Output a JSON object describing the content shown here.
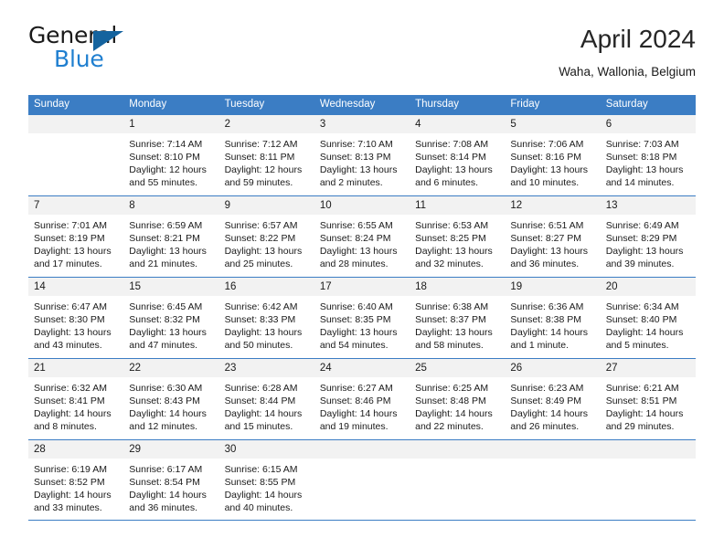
{
  "logo": {
    "word_one": "General",
    "word_two": "Blue",
    "triangle_color": "#14639e",
    "blue_color": "#1f7fd0"
  },
  "header": {
    "title": "April 2024",
    "location": "Waha, Wallonia, Belgium"
  },
  "theme": {
    "header_blue": "#3b7dc4",
    "daynum_bg": "#f2f2f2",
    "text": "#1a1a1a"
  },
  "calendar": {
    "weekdays": [
      "Sunday",
      "Monday",
      "Tuesday",
      "Wednesday",
      "Thursday",
      "Friday",
      "Saturday"
    ],
    "weeks": [
      [
        {
          "day": "",
          "sunrise": "",
          "sunset": "",
          "daylight": ""
        },
        {
          "day": "1",
          "sunrise": "Sunrise: 7:14 AM",
          "sunset": "Sunset: 8:10 PM",
          "daylight": "Daylight: 12 hours and 55 minutes."
        },
        {
          "day": "2",
          "sunrise": "Sunrise: 7:12 AM",
          "sunset": "Sunset: 8:11 PM",
          "daylight": "Daylight: 12 hours and 59 minutes."
        },
        {
          "day": "3",
          "sunrise": "Sunrise: 7:10 AM",
          "sunset": "Sunset: 8:13 PM",
          "daylight": "Daylight: 13 hours and 2 minutes."
        },
        {
          "day": "4",
          "sunrise": "Sunrise: 7:08 AM",
          "sunset": "Sunset: 8:14 PM",
          "daylight": "Daylight: 13 hours and 6 minutes."
        },
        {
          "day": "5",
          "sunrise": "Sunrise: 7:06 AM",
          "sunset": "Sunset: 8:16 PM",
          "daylight": "Daylight: 13 hours and 10 minutes."
        },
        {
          "day": "6",
          "sunrise": "Sunrise: 7:03 AM",
          "sunset": "Sunset: 8:18 PM",
          "daylight": "Daylight: 13 hours and 14 minutes."
        }
      ],
      [
        {
          "day": "7",
          "sunrise": "Sunrise: 7:01 AM",
          "sunset": "Sunset: 8:19 PM",
          "daylight": "Daylight: 13 hours and 17 minutes."
        },
        {
          "day": "8",
          "sunrise": "Sunrise: 6:59 AM",
          "sunset": "Sunset: 8:21 PM",
          "daylight": "Daylight: 13 hours and 21 minutes."
        },
        {
          "day": "9",
          "sunrise": "Sunrise: 6:57 AM",
          "sunset": "Sunset: 8:22 PM",
          "daylight": "Daylight: 13 hours and 25 minutes."
        },
        {
          "day": "10",
          "sunrise": "Sunrise: 6:55 AM",
          "sunset": "Sunset: 8:24 PM",
          "daylight": "Daylight: 13 hours and 28 minutes."
        },
        {
          "day": "11",
          "sunrise": "Sunrise: 6:53 AM",
          "sunset": "Sunset: 8:25 PM",
          "daylight": "Daylight: 13 hours and 32 minutes."
        },
        {
          "day": "12",
          "sunrise": "Sunrise: 6:51 AM",
          "sunset": "Sunset: 8:27 PM",
          "daylight": "Daylight: 13 hours and 36 minutes."
        },
        {
          "day": "13",
          "sunrise": "Sunrise: 6:49 AM",
          "sunset": "Sunset: 8:29 PM",
          "daylight": "Daylight: 13 hours and 39 minutes."
        }
      ],
      [
        {
          "day": "14",
          "sunrise": "Sunrise: 6:47 AM",
          "sunset": "Sunset: 8:30 PM",
          "daylight": "Daylight: 13 hours and 43 minutes."
        },
        {
          "day": "15",
          "sunrise": "Sunrise: 6:45 AM",
          "sunset": "Sunset: 8:32 PM",
          "daylight": "Daylight: 13 hours and 47 minutes."
        },
        {
          "day": "16",
          "sunrise": "Sunrise: 6:42 AM",
          "sunset": "Sunset: 8:33 PM",
          "daylight": "Daylight: 13 hours and 50 minutes."
        },
        {
          "day": "17",
          "sunrise": "Sunrise: 6:40 AM",
          "sunset": "Sunset: 8:35 PM",
          "daylight": "Daylight: 13 hours and 54 minutes."
        },
        {
          "day": "18",
          "sunrise": "Sunrise: 6:38 AM",
          "sunset": "Sunset: 8:37 PM",
          "daylight": "Daylight: 13 hours and 58 minutes."
        },
        {
          "day": "19",
          "sunrise": "Sunrise: 6:36 AM",
          "sunset": "Sunset: 8:38 PM",
          "daylight": "Daylight: 14 hours and 1 minute."
        },
        {
          "day": "20",
          "sunrise": "Sunrise: 6:34 AM",
          "sunset": "Sunset: 8:40 PM",
          "daylight": "Daylight: 14 hours and 5 minutes."
        }
      ],
      [
        {
          "day": "21",
          "sunrise": "Sunrise: 6:32 AM",
          "sunset": "Sunset: 8:41 PM",
          "daylight": "Daylight: 14 hours and 8 minutes."
        },
        {
          "day": "22",
          "sunrise": "Sunrise: 6:30 AM",
          "sunset": "Sunset: 8:43 PM",
          "daylight": "Daylight: 14 hours and 12 minutes."
        },
        {
          "day": "23",
          "sunrise": "Sunrise: 6:28 AM",
          "sunset": "Sunset: 8:44 PM",
          "daylight": "Daylight: 14 hours and 15 minutes."
        },
        {
          "day": "24",
          "sunrise": "Sunrise: 6:27 AM",
          "sunset": "Sunset: 8:46 PM",
          "daylight": "Daylight: 14 hours and 19 minutes."
        },
        {
          "day": "25",
          "sunrise": "Sunrise: 6:25 AM",
          "sunset": "Sunset: 8:48 PM",
          "daylight": "Daylight: 14 hours and 22 minutes."
        },
        {
          "day": "26",
          "sunrise": "Sunrise: 6:23 AM",
          "sunset": "Sunset: 8:49 PM",
          "daylight": "Daylight: 14 hours and 26 minutes."
        },
        {
          "day": "27",
          "sunrise": "Sunrise: 6:21 AM",
          "sunset": "Sunset: 8:51 PM",
          "daylight": "Daylight: 14 hours and 29 minutes."
        }
      ],
      [
        {
          "day": "28",
          "sunrise": "Sunrise: 6:19 AM",
          "sunset": "Sunset: 8:52 PM",
          "daylight": "Daylight: 14 hours and 33 minutes."
        },
        {
          "day": "29",
          "sunrise": "Sunrise: 6:17 AM",
          "sunset": "Sunset: 8:54 PM",
          "daylight": "Daylight: 14 hours and 36 minutes."
        },
        {
          "day": "30",
          "sunrise": "Sunrise: 6:15 AM",
          "sunset": "Sunset: 8:55 PM",
          "daylight": "Daylight: 14 hours and 40 minutes."
        },
        {
          "day": "",
          "sunrise": "",
          "sunset": "",
          "daylight": ""
        },
        {
          "day": "",
          "sunrise": "",
          "sunset": "",
          "daylight": ""
        },
        {
          "day": "",
          "sunrise": "",
          "sunset": "",
          "daylight": ""
        },
        {
          "day": "",
          "sunrise": "",
          "sunset": "",
          "daylight": ""
        }
      ]
    ]
  }
}
